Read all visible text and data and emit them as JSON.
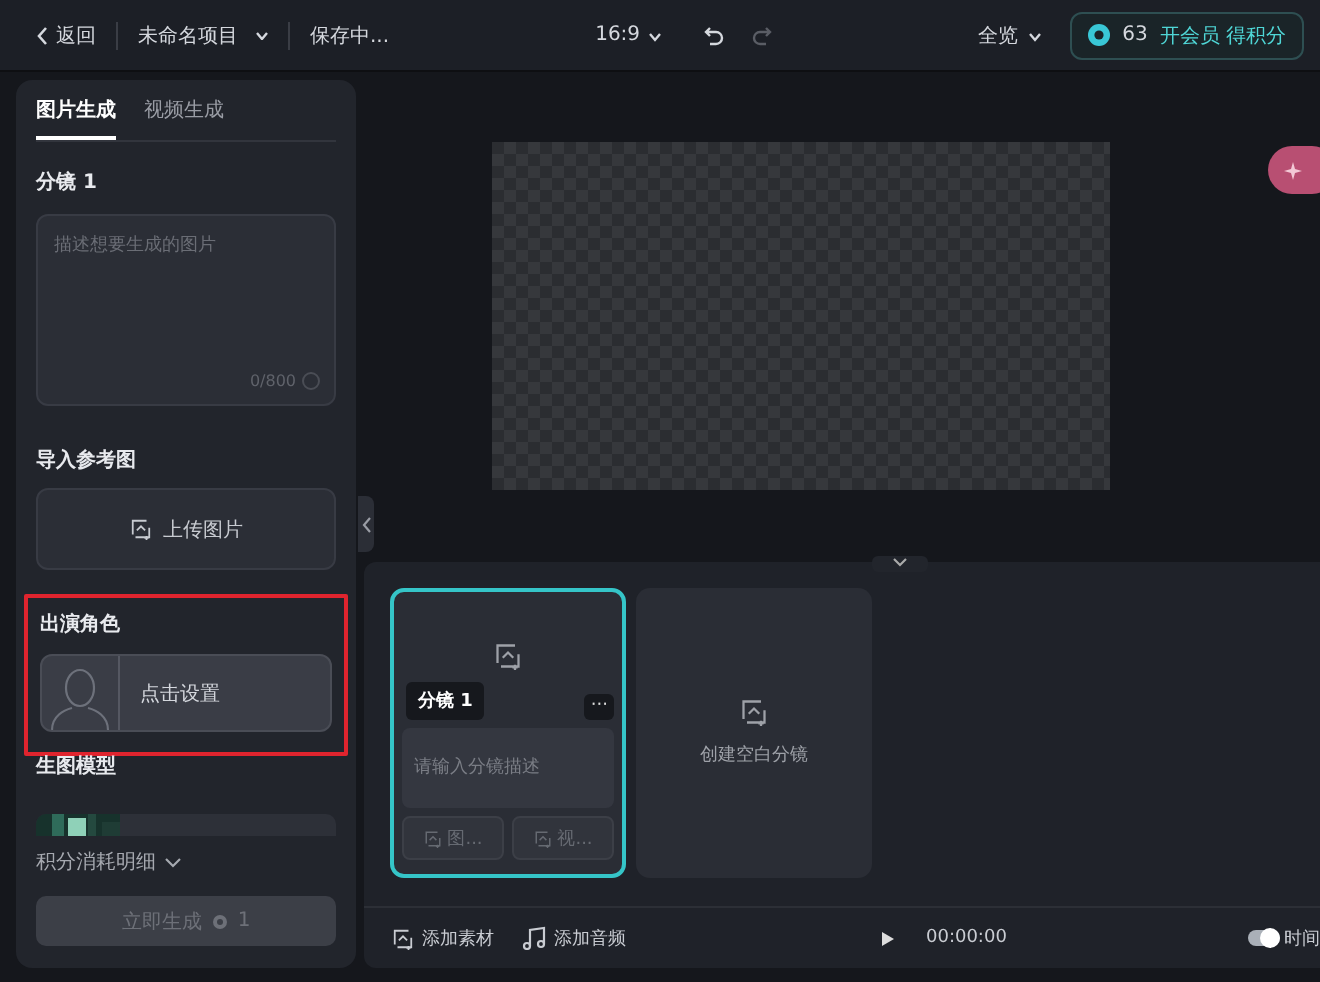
{
  "topbar": {
    "back": "返回",
    "project": "未命名项目",
    "status": "保存中...",
    "ratio": "16:9",
    "zoom": "全览",
    "credits": "63",
    "vip": "开会员 得积分"
  },
  "tabs": [
    {
      "label": "图片生成",
      "selected": true
    },
    {
      "label": "视频生成",
      "selected": false
    }
  ],
  "shot": {
    "title": "分镜 1",
    "placeholder": "描述想要生成的图片",
    "counter": "0/800"
  },
  "reference": {
    "title": "导入参考图",
    "button": "上传图片"
  },
  "cast": {
    "title": "出演角色",
    "button": "点击设置",
    "highlighted": true
  },
  "model": {
    "title": "生图模型"
  },
  "cost": {
    "label": "积分消耗明细"
  },
  "generate": {
    "label": "立即生成",
    "cost": "1",
    "disabled": true
  },
  "cards": [
    {
      "kind": "shot",
      "label": "分镜 1",
      "placeholder": "请输入分镜描述",
      "selected": true,
      "more": "···",
      "actions": [
        "图...",
        "视..."
      ]
    },
    {
      "kind": "blank",
      "label": "创建空白分镜",
      "selected": false
    }
  ],
  "timeline": {
    "add_material": "添加素材",
    "add_audio": "添加音频",
    "time": "00:00:00",
    "toggle_on": true,
    "toggle_label": "时间"
  }
}
